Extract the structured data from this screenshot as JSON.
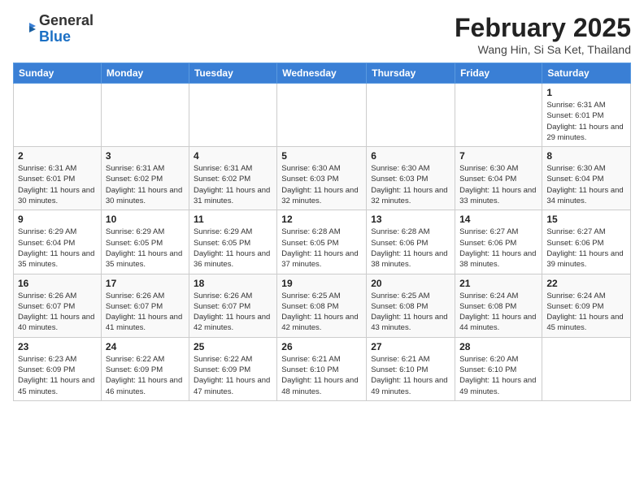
{
  "header": {
    "logo_general": "General",
    "logo_blue": "Blue",
    "month_title": "February 2025",
    "location": "Wang Hin, Si Sa Ket, Thailand"
  },
  "weekdays": [
    "Sunday",
    "Monday",
    "Tuesday",
    "Wednesday",
    "Thursday",
    "Friday",
    "Saturday"
  ],
  "weeks": [
    [
      {
        "day": "",
        "info": ""
      },
      {
        "day": "",
        "info": ""
      },
      {
        "day": "",
        "info": ""
      },
      {
        "day": "",
        "info": ""
      },
      {
        "day": "",
        "info": ""
      },
      {
        "day": "",
        "info": ""
      },
      {
        "day": "1",
        "info": "Sunrise: 6:31 AM\nSunset: 6:01 PM\nDaylight: 11 hours and 29 minutes."
      }
    ],
    [
      {
        "day": "2",
        "info": "Sunrise: 6:31 AM\nSunset: 6:01 PM\nDaylight: 11 hours and 30 minutes."
      },
      {
        "day": "3",
        "info": "Sunrise: 6:31 AM\nSunset: 6:02 PM\nDaylight: 11 hours and 30 minutes."
      },
      {
        "day": "4",
        "info": "Sunrise: 6:31 AM\nSunset: 6:02 PM\nDaylight: 11 hours and 31 minutes."
      },
      {
        "day": "5",
        "info": "Sunrise: 6:30 AM\nSunset: 6:03 PM\nDaylight: 11 hours and 32 minutes."
      },
      {
        "day": "6",
        "info": "Sunrise: 6:30 AM\nSunset: 6:03 PM\nDaylight: 11 hours and 32 minutes."
      },
      {
        "day": "7",
        "info": "Sunrise: 6:30 AM\nSunset: 6:04 PM\nDaylight: 11 hours and 33 minutes."
      },
      {
        "day": "8",
        "info": "Sunrise: 6:30 AM\nSunset: 6:04 PM\nDaylight: 11 hours and 34 minutes."
      }
    ],
    [
      {
        "day": "9",
        "info": "Sunrise: 6:29 AM\nSunset: 6:04 PM\nDaylight: 11 hours and 35 minutes."
      },
      {
        "day": "10",
        "info": "Sunrise: 6:29 AM\nSunset: 6:05 PM\nDaylight: 11 hours and 35 minutes."
      },
      {
        "day": "11",
        "info": "Sunrise: 6:29 AM\nSunset: 6:05 PM\nDaylight: 11 hours and 36 minutes."
      },
      {
        "day": "12",
        "info": "Sunrise: 6:28 AM\nSunset: 6:05 PM\nDaylight: 11 hours and 37 minutes."
      },
      {
        "day": "13",
        "info": "Sunrise: 6:28 AM\nSunset: 6:06 PM\nDaylight: 11 hours and 38 minutes."
      },
      {
        "day": "14",
        "info": "Sunrise: 6:27 AM\nSunset: 6:06 PM\nDaylight: 11 hours and 38 minutes."
      },
      {
        "day": "15",
        "info": "Sunrise: 6:27 AM\nSunset: 6:06 PM\nDaylight: 11 hours and 39 minutes."
      }
    ],
    [
      {
        "day": "16",
        "info": "Sunrise: 6:26 AM\nSunset: 6:07 PM\nDaylight: 11 hours and 40 minutes."
      },
      {
        "day": "17",
        "info": "Sunrise: 6:26 AM\nSunset: 6:07 PM\nDaylight: 11 hours and 41 minutes."
      },
      {
        "day": "18",
        "info": "Sunrise: 6:26 AM\nSunset: 6:07 PM\nDaylight: 11 hours and 42 minutes."
      },
      {
        "day": "19",
        "info": "Sunrise: 6:25 AM\nSunset: 6:08 PM\nDaylight: 11 hours and 42 minutes."
      },
      {
        "day": "20",
        "info": "Sunrise: 6:25 AM\nSunset: 6:08 PM\nDaylight: 11 hours and 43 minutes."
      },
      {
        "day": "21",
        "info": "Sunrise: 6:24 AM\nSunset: 6:08 PM\nDaylight: 11 hours and 44 minutes."
      },
      {
        "day": "22",
        "info": "Sunrise: 6:24 AM\nSunset: 6:09 PM\nDaylight: 11 hours and 45 minutes."
      }
    ],
    [
      {
        "day": "23",
        "info": "Sunrise: 6:23 AM\nSunset: 6:09 PM\nDaylight: 11 hours and 45 minutes."
      },
      {
        "day": "24",
        "info": "Sunrise: 6:22 AM\nSunset: 6:09 PM\nDaylight: 11 hours and 46 minutes."
      },
      {
        "day": "25",
        "info": "Sunrise: 6:22 AM\nSunset: 6:09 PM\nDaylight: 11 hours and 47 minutes."
      },
      {
        "day": "26",
        "info": "Sunrise: 6:21 AM\nSunset: 6:10 PM\nDaylight: 11 hours and 48 minutes."
      },
      {
        "day": "27",
        "info": "Sunrise: 6:21 AM\nSunset: 6:10 PM\nDaylight: 11 hours and 49 minutes."
      },
      {
        "day": "28",
        "info": "Sunrise: 6:20 AM\nSunset: 6:10 PM\nDaylight: 11 hours and 49 minutes."
      },
      {
        "day": "",
        "info": ""
      }
    ]
  ]
}
